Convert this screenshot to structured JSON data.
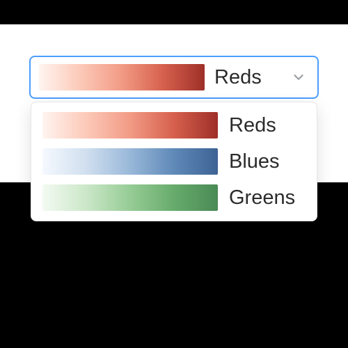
{
  "colormap_select": {
    "selected": {
      "label": "Reds",
      "swatch_class": "swatch-reds"
    },
    "options": [
      {
        "label": "Reds",
        "swatch_class": "swatch-reds"
      },
      {
        "label": "Blues",
        "swatch_class": "swatch-blues"
      },
      {
        "label": "Greens",
        "swatch_class": "swatch-greens"
      }
    ]
  }
}
